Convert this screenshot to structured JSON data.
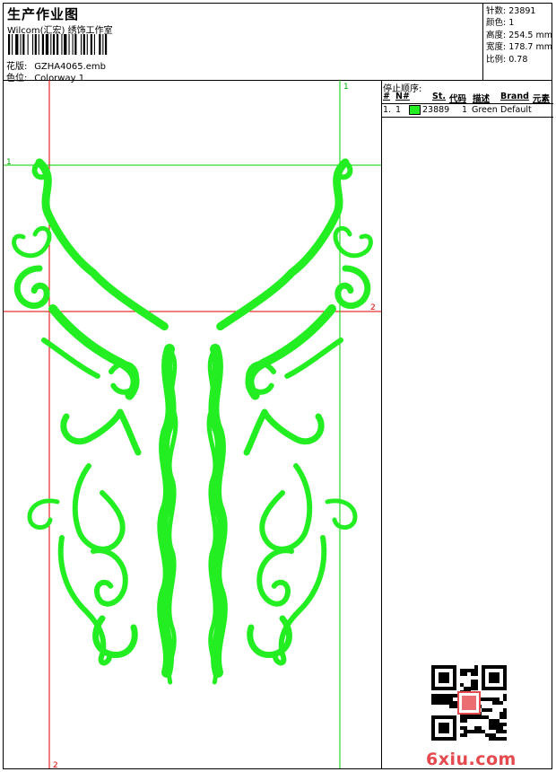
{
  "header": {
    "title": "生产作业图",
    "subtitle": "Wilcom(汇宏) 绣饰工作室",
    "pattern_label": "花版:",
    "pattern_value": "GZHA4065.emb",
    "color_label": "色位:",
    "color_value": "Colorway 1"
  },
  "stats": [
    {
      "label": "针数:",
      "value": "23891"
    },
    {
      "label": "颜色:",
      "value": "1"
    },
    {
      "label": "高度:",
      "value": "254.5 mm"
    },
    {
      "label": "宽度:",
      "value": "178.7 mm"
    },
    {
      "label": "比例:",
      "value": "0.78"
    }
  ],
  "stop_sequence": {
    "title": "停止顺序:",
    "columns": [
      "#",
      "N#",
      "St.",
      "代码",
      "描述",
      "Brand",
      "元素"
    ],
    "rows": [
      {
        "num": "1.",
        "needle": "1",
        "stitches": "23889",
        "code": "1",
        "desc": "Green",
        "brand": "Default",
        "color": "#22ee22"
      }
    ]
  },
  "guides": {
    "labels": [
      "1",
      "1",
      "2",
      "2"
    ]
  },
  "colors": {
    "thread": "#22ee22",
    "guide_red": "#e00000",
    "guide_green": "#00cc00"
  },
  "watermark": {
    "text": "6xiu.com"
  }
}
